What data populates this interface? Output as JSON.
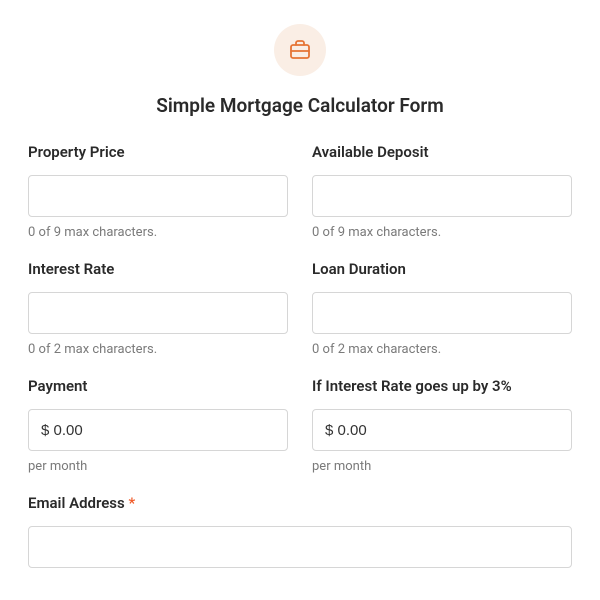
{
  "header": {
    "title": "Simple Mortgage Calculator Form"
  },
  "fields": {
    "propertyPrice": {
      "label": "Property Price",
      "value": "",
      "helper": "0 of 9 max characters."
    },
    "availableDeposit": {
      "label": "Available Deposit",
      "value": "",
      "helper": "0 of 9 max characters."
    },
    "interestRate": {
      "label": "Interest Rate",
      "value": "",
      "helper": "0 of 2 max characters."
    },
    "loanDuration": {
      "label": "Loan Duration",
      "value": "",
      "helper": "0 of 2 max characters."
    },
    "payment": {
      "label": "Payment",
      "value": "$ 0.00",
      "helper": "per month"
    },
    "interestRateUp": {
      "label": "If Interest Rate goes up by 3%",
      "value": "$ 0.00",
      "helper": "per month"
    },
    "email": {
      "label": "Email Address",
      "value": "",
      "requiredMark": "*"
    }
  }
}
